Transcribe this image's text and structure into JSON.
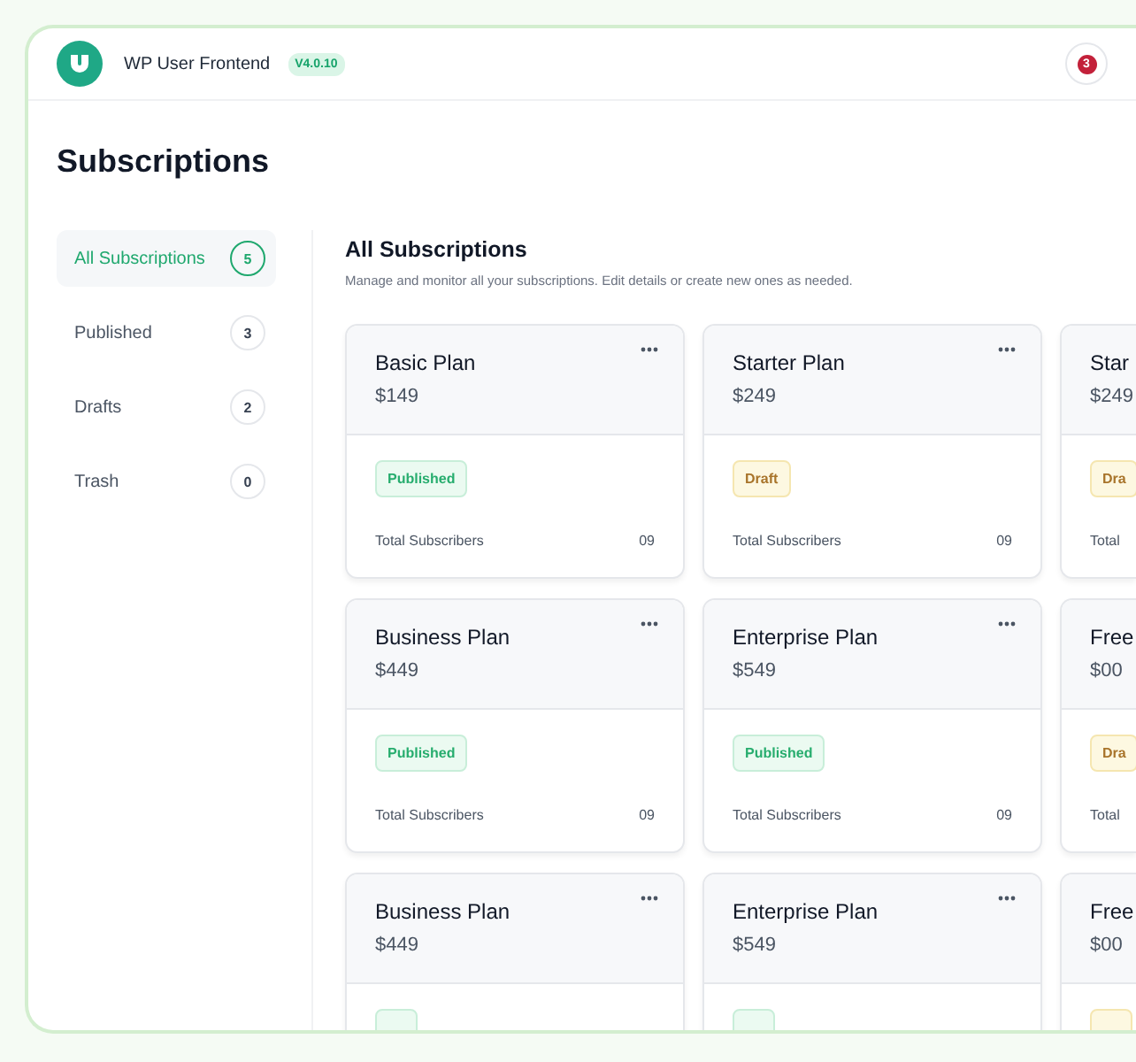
{
  "header": {
    "app_name": "WP User Frontend",
    "version": "V4.0.10",
    "notifications": "3"
  },
  "page_title": "Subscriptions",
  "sidebar": {
    "items": [
      {
        "label": "All Subscriptions",
        "count": "5",
        "selected": true
      },
      {
        "label": "Published",
        "count": "3",
        "selected": false
      },
      {
        "label": "Drafts",
        "count": "2",
        "selected": false
      },
      {
        "label": "Trash",
        "count": "0",
        "selected": false
      }
    ]
  },
  "content": {
    "title": "All Subscriptions",
    "description": "Manage and monitor all your subscriptions. Edit details or create new ones as needed.",
    "cards": [
      {
        "name": "Basic Plan",
        "price": "$149",
        "kind": "published",
        "status_label": "Published",
        "subscribers_label": "Total Subscribers",
        "subscribers": "09"
      },
      {
        "name": "Starter Plan",
        "price": "$249",
        "kind": "draft",
        "status_label": "Draft",
        "subscribers_label": "Total Subscribers",
        "subscribers": "09"
      },
      {
        "name": "Star",
        "price": "$249",
        "kind": "draft",
        "status_label": "Dra",
        "subscribers_label": "Total"
      },
      {
        "name": "Business Plan",
        "price": "$449",
        "kind": "published",
        "status_label": "Published",
        "subscribers_label": "Total Subscribers",
        "subscribers": "09"
      },
      {
        "name": "Enterprise Plan",
        "price": "$549",
        "kind": "published",
        "status_label": "Published",
        "subscribers_label": "Total Subscribers",
        "subscribers": "09"
      },
      {
        "name": "Free",
        "price": "$00",
        "kind": "draft",
        "status_label": "Dra",
        "subscribers_label": "Total"
      },
      {
        "name": "Business Plan",
        "price": "$449",
        "kind": "published"
      },
      {
        "name": "Enterprise Plan",
        "price": "$549",
        "kind": "published"
      },
      {
        "name": "Free",
        "price": "$00",
        "kind": "draft"
      }
    ]
  }
}
